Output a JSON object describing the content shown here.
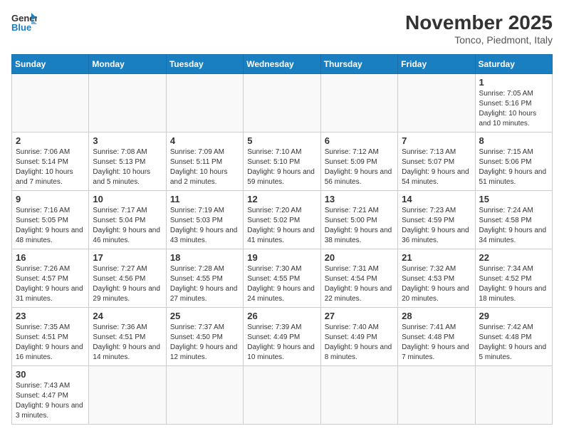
{
  "header": {
    "logo_general": "General",
    "logo_blue": "Blue",
    "month": "November 2025",
    "location": "Tonco, Piedmont, Italy"
  },
  "weekdays": [
    "Sunday",
    "Monday",
    "Tuesday",
    "Wednesday",
    "Thursday",
    "Friday",
    "Saturday"
  ],
  "days": {
    "1": {
      "sunrise": "7:05 AM",
      "sunset": "5:16 PM",
      "daylight": "10 hours and 10 minutes."
    },
    "2": {
      "sunrise": "7:06 AM",
      "sunset": "5:14 PM",
      "daylight": "10 hours and 7 minutes."
    },
    "3": {
      "sunrise": "7:08 AM",
      "sunset": "5:13 PM",
      "daylight": "10 hours and 5 minutes."
    },
    "4": {
      "sunrise": "7:09 AM",
      "sunset": "5:11 PM",
      "daylight": "10 hours and 2 minutes."
    },
    "5": {
      "sunrise": "7:10 AM",
      "sunset": "5:10 PM",
      "daylight": "9 hours and 59 minutes."
    },
    "6": {
      "sunrise": "7:12 AM",
      "sunset": "5:09 PM",
      "daylight": "9 hours and 56 minutes."
    },
    "7": {
      "sunrise": "7:13 AM",
      "sunset": "5:07 PM",
      "daylight": "9 hours and 54 minutes."
    },
    "8": {
      "sunrise": "7:15 AM",
      "sunset": "5:06 PM",
      "daylight": "9 hours and 51 minutes."
    },
    "9": {
      "sunrise": "7:16 AM",
      "sunset": "5:05 PM",
      "daylight": "9 hours and 48 minutes."
    },
    "10": {
      "sunrise": "7:17 AM",
      "sunset": "5:04 PM",
      "daylight": "9 hours and 46 minutes."
    },
    "11": {
      "sunrise": "7:19 AM",
      "sunset": "5:03 PM",
      "daylight": "9 hours and 43 minutes."
    },
    "12": {
      "sunrise": "7:20 AM",
      "sunset": "5:02 PM",
      "daylight": "9 hours and 41 minutes."
    },
    "13": {
      "sunrise": "7:21 AM",
      "sunset": "5:00 PM",
      "daylight": "9 hours and 38 minutes."
    },
    "14": {
      "sunrise": "7:23 AM",
      "sunset": "4:59 PM",
      "daylight": "9 hours and 36 minutes."
    },
    "15": {
      "sunrise": "7:24 AM",
      "sunset": "4:58 PM",
      "daylight": "9 hours and 34 minutes."
    },
    "16": {
      "sunrise": "7:26 AM",
      "sunset": "4:57 PM",
      "daylight": "9 hours and 31 minutes."
    },
    "17": {
      "sunrise": "7:27 AM",
      "sunset": "4:56 PM",
      "daylight": "9 hours and 29 minutes."
    },
    "18": {
      "sunrise": "7:28 AM",
      "sunset": "4:55 PM",
      "daylight": "9 hours and 27 minutes."
    },
    "19": {
      "sunrise": "7:30 AM",
      "sunset": "4:55 PM",
      "daylight": "9 hours and 24 minutes."
    },
    "20": {
      "sunrise": "7:31 AM",
      "sunset": "4:54 PM",
      "daylight": "9 hours and 22 minutes."
    },
    "21": {
      "sunrise": "7:32 AM",
      "sunset": "4:53 PM",
      "daylight": "9 hours and 20 minutes."
    },
    "22": {
      "sunrise": "7:34 AM",
      "sunset": "4:52 PM",
      "daylight": "9 hours and 18 minutes."
    },
    "23": {
      "sunrise": "7:35 AM",
      "sunset": "4:51 PM",
      "daylight": "9 hours and 16 minutes."
    },
    "24": {
      "sunrise": "7:36 AM",
      "sunset": "4:51 PM",
      "daylight": "9 hours and 14 minutes."
    },
    "25": {
      "sunrise": "7:37 AM",
      "sunset": "4:50 PM",
      "daylight": "9 hours and 12 minutes."
    },
    "26": {
      "sunrise": "7:39 AM",
      "sunset": "4:49 PM",
      "daylight": "9 hours and 10 minutes."
    },
    "27": {
      "sunrise": "7:40 AM",
      "sunset": "4:49 PM",
      "daylight": "9 hours and 8 minutes."
    },
    "28": {
      "sunrise": "7:41 AM",
      "sunset": "4:48 PM",
      "daylight": "9 hours and 7 minutes."
    },
    "29": {
      "sunrise": "7:42 AM",
      "sunset": "4:48 PM",
      "daylight": "9 hours and 5 minutes."
    },
    "30": {
      "sunrise": "7:43 AM",
      "sunset": "4:47 PM",
      "daylight": "9 hours and 3 minutes."
    }
  }
}
